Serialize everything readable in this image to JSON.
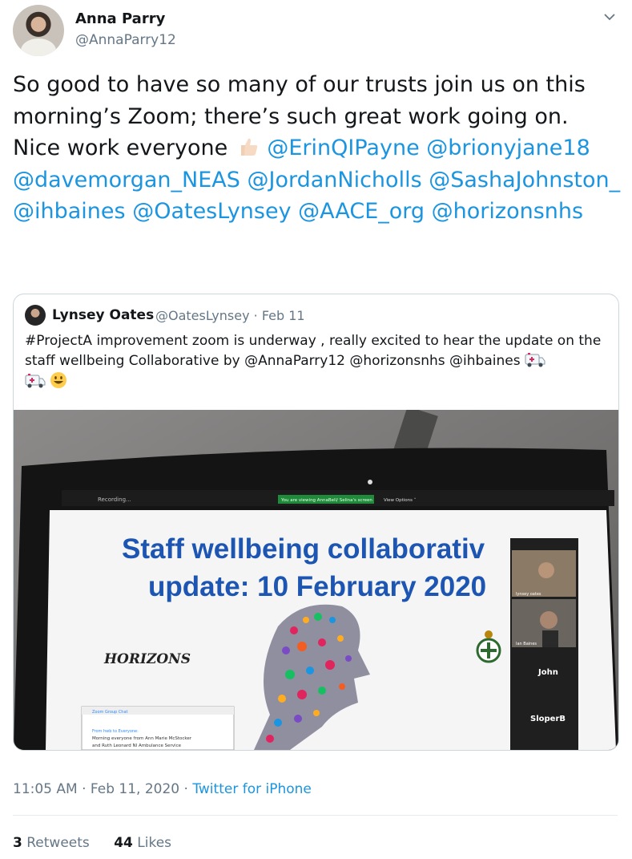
{
  "author": {
    "display_name": "Anna Parry",
    "handle": "@AnnaParry12"
  },
  "tweet": {
    "text_part1": "So good to have so many of our trusts join us on this morning’s Zoom; there’s such great work going on. Nice work everyone",
    "thumb_emoji": "thumbs-up-light-skin-icon",
    "mentions": [
      "@ErinQIPayne",
      "@brionyjane18",
      "@davemorgan_NEAS",
      "@JordanNicholls",
      "@SashaJohnston_",
      "@ihbaines",
      "@OatesLynsey",
      "@AACE_org",
      "@horizonsnhs"
    ]
  },
  "quoted_tweet": {
    "display_name": "Lynsey Oates",
    "handle_date": "@OatesLynsey · Feb 11",
    "text": "#ProjectA improvement zoom is underway , really excited to hear the update on the staff wellbeing Collaborative by @AnnaParry12 @horizonsnhs @ihbaines",
    "image": {
      "slide_title_line1": "Staff wellbeing collaborativ",
      "slide_title_line2": "update: 10 February 2020",
      "logo_text": "HORIZONS",
      "zoom_recording": "Recording...",
      "zoom_banner": "You are viewing AnnaBell/ Selina's screen",
      "view_options": "View Options ˅",
      "participant_1": "John",
      "participant_2": "SloperB",
      "participant_top": "lynsey oates",
      "participant_mid": "Ian Baines",
      "chat_title": "Zoom Group Chat",
      "chat_from": "From hwb to Everyone:",
      "chat_line1": "Morning everyone from Ann Marie McStocker",
      "chat_line2": "and Ruth Leonard NI Ambulance Service"
    }
  },
  "meta": {
    "time_date": "11:05 AM · Feb 11, 2020 ·",
    "source": "Twitter for iPhone"
  },
  "stats": {
    "retweets_count": "3",
    "retweets_label": "Retweets",
    "likes_count": "44",
    "likes_label": "Likes"
  },
  "colors": {
    "link": "#1b95e0",
    "secondary_text": "#657786",
    "primary_text": "#14171a",
    "slide_title": "#1d55b3"
  }
}
